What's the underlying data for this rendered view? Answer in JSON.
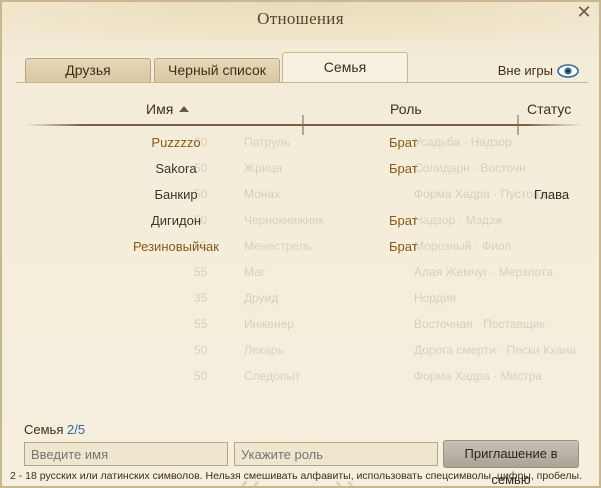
{
  "window": {
    "title": "Отношения"
  },
  "tabs": [
    {
      "label": "Друзья",
      "active": false
    },
    {
      "label": "Черный список",
      "active": false
    },
    {
      "label": "Семья",
      "active": true
    }
  ],
  "offline_toggle": {
    "label": "Вне игры",
    "icon": "eye-icon"
  },
  "table": {
    "headers": {
      "name": "Имя",
      "role": "Роль",
      "status": "Статус"
    },
    "rows": [
      {
        "name": "Puzzzzo",
        "role": "Брат",
        "status": "",
        "online": true
      },
      {
        "name": "Sakora",
        "role": "Брат",
        "status": "",
        "online": false
      },
      {
        "name": "Банкир",
        "role": "",
        "status": "Глава",
        "online": false
      },
      {
        "name": "Дигидон",
        "role": "Брат",
        "status": "",
        "online": false
      },
      {
        "name": "Резиновыйчак",
        "role": "Брат",
        "status": "",
        "online": true
      }
    ]
  },
  "footer": {
    "family_label": "Семья",
    "family_count": "2/5",
    "name_placeholder": "Введите имя",
    "role_placeholder": "Укажите роль",
    "invite_label": "Приглашение в семью",
    "hint": "2 - 18 русских или латинских символов. Нельзя смешивать алфавиты, использовать спецсимволы, цифры, пробелы."
  },
  "colors": {
    "online_name": "#8a5a12",
    "count_accent": "#2f6a9a"
  }
}
